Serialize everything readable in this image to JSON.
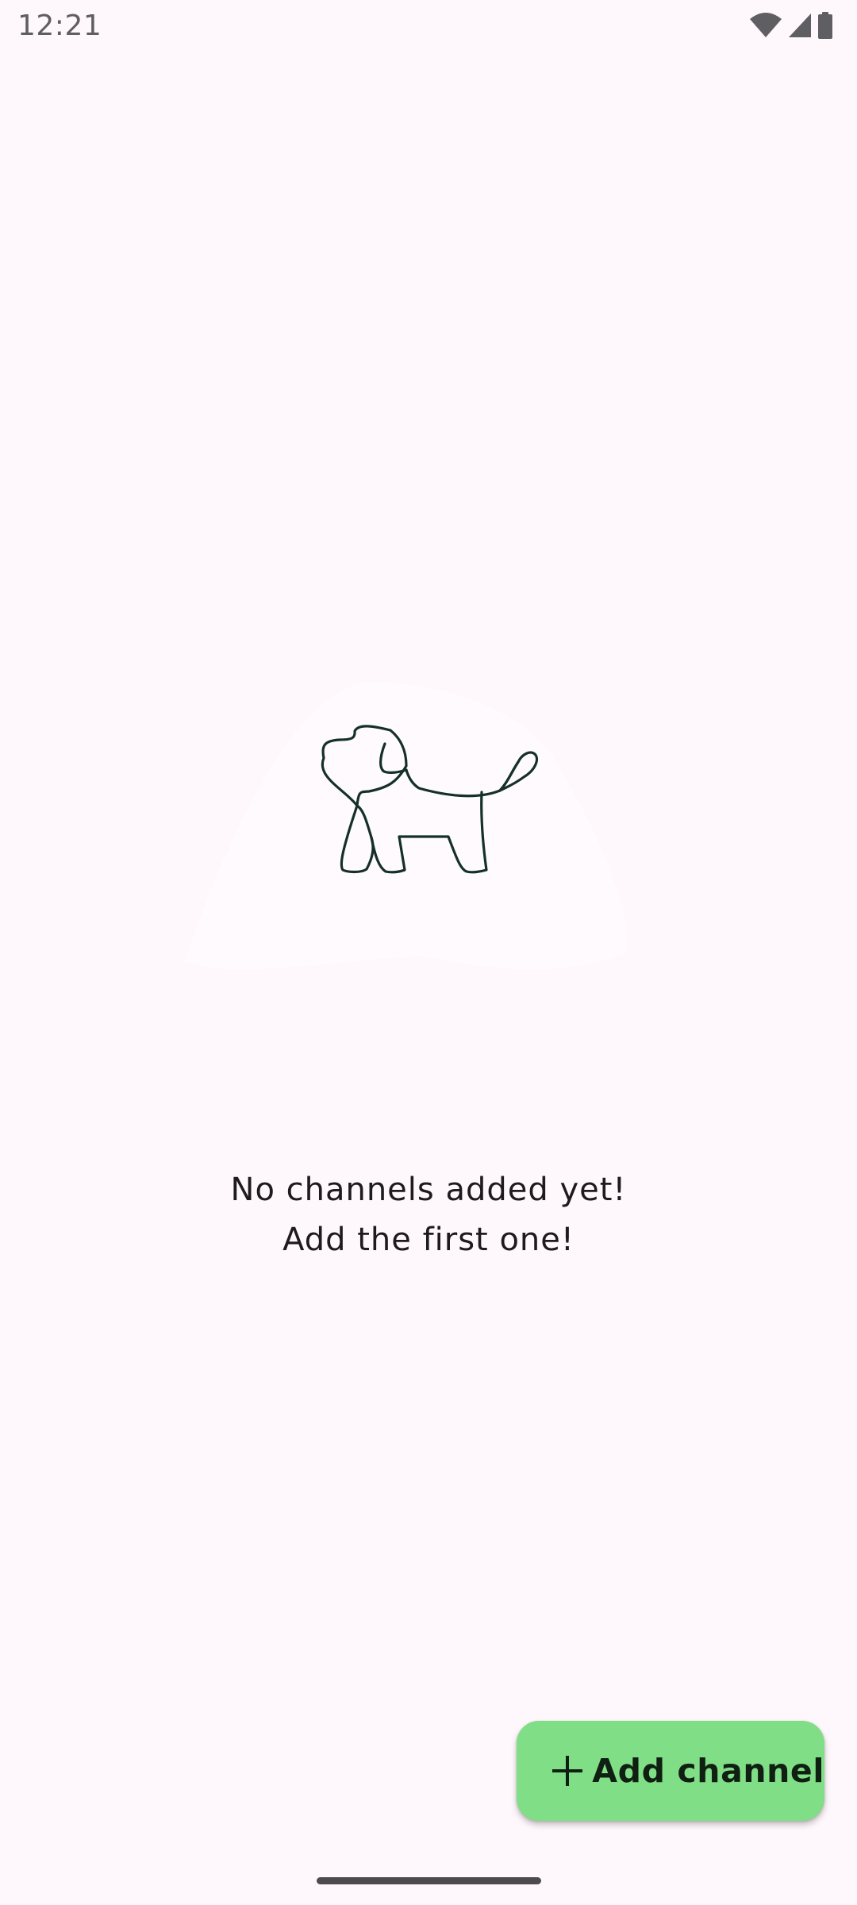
{
  "status_bar": {
    "time": "12:21",
    "icons": [
      "wifi-icon",
      "cellular-signal-icon",
      "battery-icon"
    ]
  },
  "empty_state": {
    "illustration": "dog-line-drawing",
    "line1": "No channels added yet!",
    "line2": "Add the first one!"
  },
  "fab": {
    "icon": "plus-icon",
    "label": "Add channel",
    "color": "#80de86"
  },
  "theme": {
    "background": "#fef7fb",
    "text": "#1d1b20"
  }
}
